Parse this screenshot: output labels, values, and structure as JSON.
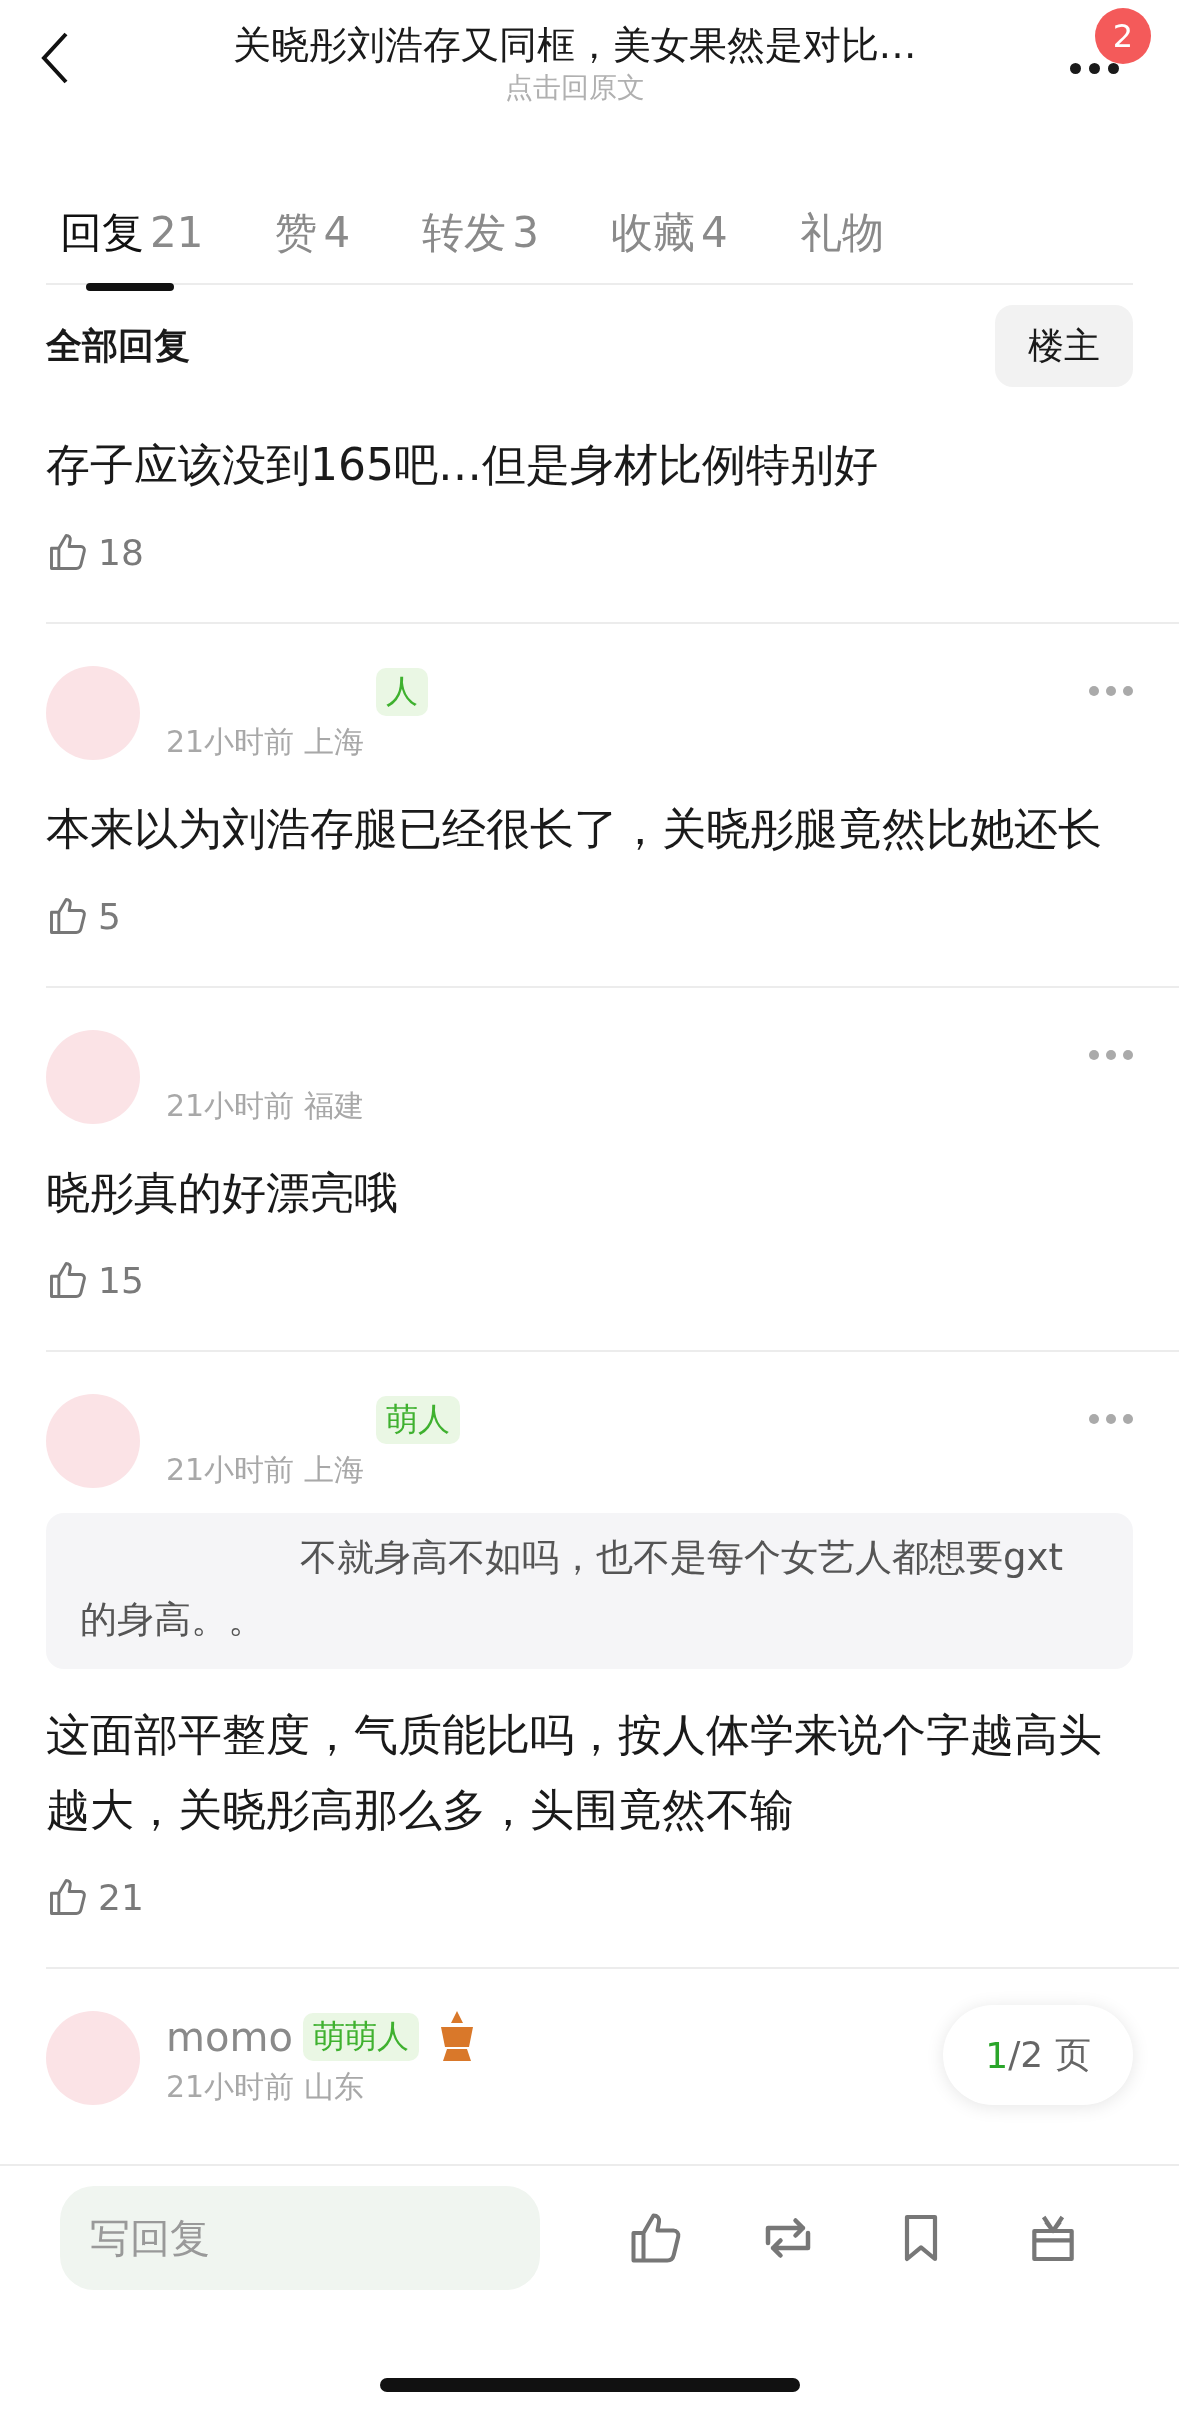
{
  "header": {
    "title": "关晓彤刘浩存又同框，美女果然是对比…",
    "subtitle": "点击回原文",
    "notification_count": "2"
  },
  "tabs": [
    {
      "label": "回复",
      "count": "21",
      "selected": true
    },
    {
      "label": "赞",
      "count": "4",
      "selected": false
    },
    {
      "label": "转发",
      "count": "3",
      "selected": false
    },
    {
      "label": "收藏",
      "count": "4",
      "selected": false
    },
    {
      "label": "礼物",
      "selected": false
    }
  ],
  "filter": {
    "label": "全部回复",
    "button": "楼主"
  },
  "top_reply": {
    "text": "存子应该没到165吧…但是身材比例特别好",
    "likes": "18"
  },
  "comments": [
    {
      "badge": "人",
      "meta": "21小时前 上海",
      "text": "本来以为刘浩存腿已经很长了，关晓彤腿竟然比她还长",
      "likes": "5"
    },
    {
      "meta": "21小时前 福建",
      "text": "晓彤真的好漂亮哦",
      "likes": "15"
    },
    {
      "badge": "萌人",
      "meta": "21小时前 上海",
      "quote": "不就身高不如吗，也不是每个女艺人都想要gxt的身高。。",
      "text": "这面部平整度，气质能比吗，按人体学来说个字越高头越大，关晓彤高那么多，头围竟然不输",
      "likes": "21"
    },
    {
      "username": "momo",
      "badge": "萌萌人",
      "meta": "21小时前 山东"
    }
  ],
  "pagination": {
    "current": "1",
    "total": "/2 页"
  },
  "reply_bar": {
    "placeholder": "写回复"
  }
}
